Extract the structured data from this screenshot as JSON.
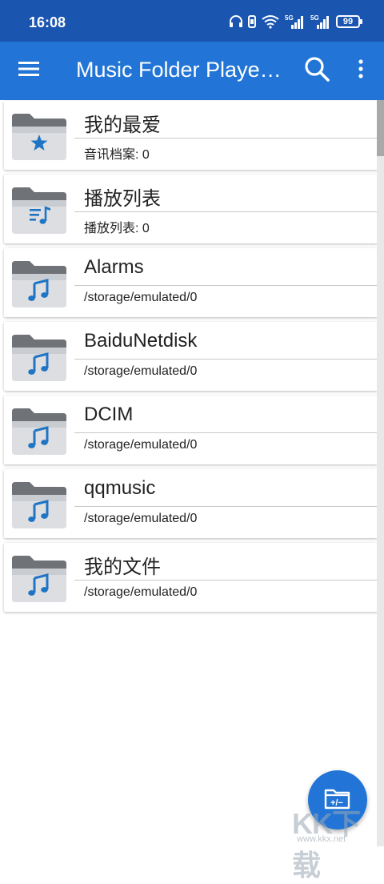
{
  "status_bar": {
    "time": "16:08",
    "battery": "99",
    "signal_1": "5G",
    "signal_2": "5G"
  },
  "app_bar": {
    "title": "Music Folder Player Free",
    "menu_icon": "hamburger-menu-icon",
    "search_icon": "search-icon",
    "more_icon": "more-vert-icon"
  },
  "folders": [
    {
      "title": "我的最爱",
      "subtitle": "音讯档案: 0",
      "icon": "star-folder-icon"
    },
    {
      "title": "播放列表",
      "subtitle": "播放列表: 0",
      "icon": "playlist-folder-icon"
    },
    {
      "title": "Alarms",
      "subtitle": "/storage/emulated/0",
      "icon": "music-folder-icon"
    },
    {
      "title": "BaiduNetdisk",
      "subtitle": "/storage/emulated/0",
      "icon": "music-folder-icon"
    },
    {
      "title": "DCIM",
      "subtitle": "/storage/emulated/0",
      "icon": "music-folder-icon"
    },
    {
      "title": "qqmusic",
      "subtitle": "/storage/emulated/0",
      "icon": "music-folder-icon"
    },
    {
      "title": " 我的文件",
      "subtitle": "/storage/emulated/0",
      "icon": "music-folder-icon"
    }
  ],
  "fab": {
    "icon": "folder-add-remove-icon"
  },
  "watermark": {
    "text": "KK下载",
    "url": "www.kkx.net"
  },
  "colors": {
    "status_bar": "#1a55b0",
    "app_bar": "#2275d6",
    "folder_accent": "#1f74c4"
  }
}
